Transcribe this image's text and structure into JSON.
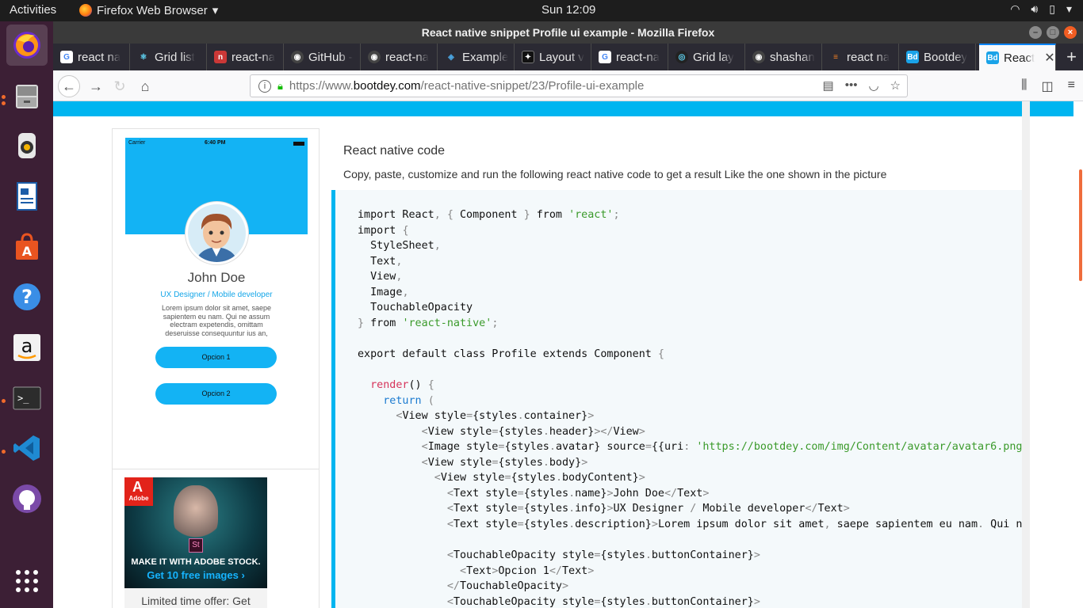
{
  "topbar": {
    "activities": "Activities",
    "app_menu": "Firefox Web Browser",
    "clock": "Sun 12:09"
  },
  "window": {
    "title": "React native snippet Profile ui example - Mozilla Firefox"
  },
  "tabs": [
    {
      "label": "react na",
      "icon": "google-icon"
    },
    {
      "label": "Grid list",
      "icon": "react-icon"
    },
    {
      "label": "react-na",
      "icon": "npm-icon"
    },
    {
      "label": "GitHub -",
      "icon": "github-icon"
    },
    {
      "label": "react-na",
      "icon": "github-icon"
    },
    {
      "label": "Example",
      "icon": "expo-icon"
    },
    {
      "label": "Layout v",
      "icon": "layout-icon"
    },
    {
      "label": "react-na",
      "icon": "google-icon"
    },
    {
      "label": "Grid lay",
      "icon": "react-dark-icon"
    },
    {
      "label": "shashan",
      "icon": "github-icon"
    },
    {
      "label": "react na",
      "icon": "stackoverflow-icon"
    },
    {
      "label": "Bootdey",
      "icon": "bootdey-icon"
    },
    {
      "label": "React",
      "icon": "bootdey-icon",
      "active": true
    }
  ],
  "url": {
    "prefix": "https://www.",
    "domain": "bootdey.com",
    "path": "/react-native-snippet/23/Profile-ui-example"
  },
  "preview": {
    "status_carrier": "Carrier",
    "status_time": "6:40 PM",
    "name": "John Doe",
    "info": "UX Designer / Mobile developer",
    "description": "Lorem ipsum dolor sit amet, saepe sapientem eu nam. Qui ne assum electram expetendis, omittam deseruisse consequuntur ius an,",
    "button1": "Opcion 1",
    "button2": "Opcion 2"
  },
  "ad": {
    "brand": "Adobe",
    "badge": "St",
    "headline": "MAKE IT WITH ADOBE STOCK.",
    "cta": "Get 10 free images ›",
    "footer": "Limited time offer: Get"
  },
  "main": {
    "title": "React native code",
    "description": "Copy, paste, customize and run the following react native code to get a result Like the one shown in the picture"
  },
  "colors": {
    "accent": "#00b5f0",
    "code_bg": "#f4f9fb",
    "dock_bg": "#3c1f35"
  }
}
